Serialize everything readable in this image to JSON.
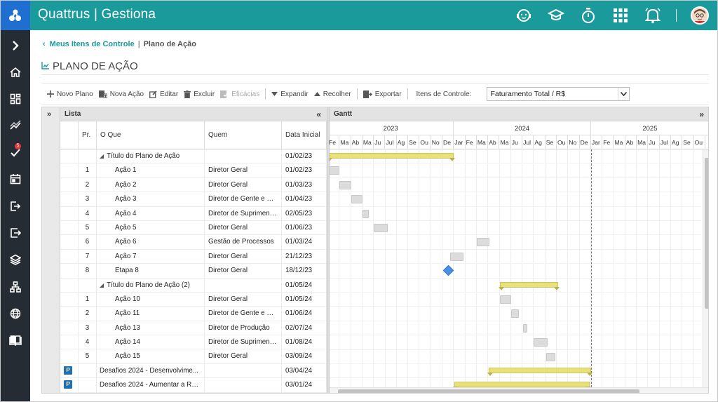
{
  "app": {
    "title": "Quattrus | Gestiona"
  },
  "topbar_icons": [
    "support-agent-icon",
    "graduation-cap-icon",
    "stopwatch-icon",
    "app-grid-icon",
    "bell-icon"
  ],
  "sidebar": {
    "items": [
      {
        "icon": "chevron-right-icon"
      },
      {
        "icon": "home-icon"
      },
      {
        "icon": "dashboard-icon"
      },
      {
        "icon": "trend-chart-icon"
      },
      {
        "icon": "tasks-check-icon",
        "badge": "5"
      },
      {
        "icon": "calendar-icon"
      },
      {
        "icon": "login-icon"
      },
      {
        "icon": "export-icon"
      },
      {
        "icon": "layers-icon"
      },
      {
        "icon": "sitemap-icon"
      },
      {
        "icon": "globe-icon"
      },
      {
        "icon": "book-icon"
      }
    ]
  },
  "breadcrumb": {
    "parent": "Meus Itens de Controle",
    "separator": "|",
    "current": "Plano de Ação"
  },
  "page": {
    "title": "PLANO DE AÇÃO"
  },
  "toolbar": {
    "novo_plano": "Novo Plano",
    "nova_acao": "Nova Ação",
    "editar": "Editar",
    "excluir": "Excluir",
    "eficacias": "Eficácias",
    "expandir": "Expandir",
    "recolher": "Recolher",
    "exportar": "Exportar",
    "itens_label": "Itens de Controle:",
    "itens_value": "Faturamento Total / R$"
  },
  "list": {
    "title": "Lista",
    "columns": {
      "pr": "Pr.",
      "oque": "O Que",
      "quem": "Quem",
      "data": "Data Inicial"
    },
    "rows": [
      {
        "type": "plan",
        "pr": "",
        "oque": "Título do Plano de Ação",
        "quem": "",
        "data": "01/02/23"
      },
      {
        "type": "action",
        "pr": "1",
        "oque": "Ação 1",
        "quem": "Diretor Geral",
        "data": "01/02/23"
      },
      {
        "type": "action",
        "pr": "2",
        "oque": "Ação 2",
        "quem": "Diretor Geral",
        "data": "01/03/23"
      },
      {
        "type": "action",
        "pr": "3",
        "oque": "Ação 3",
        "quem": "Diretor de Gente e Ge...",
        "data": "01/04/23"
      },
      {
        "type": "action",
        "pr": "4",
        "oque": "Ação 4",
        "quem": "Diretor de Suprimento...",
        "data": "02/05/23"
      },
      {
        "type": "action",
        "pr": "5",
        "oque": "Ação 5",
        "quem": "Diretor Geral",
        "data": "01/06/23"
      },
      {
        "type": "action",
        "pr": "6",
        "oque": "Ação 6",
        "quem": "Gestão de Processos",
        "data": "01/03/24"
      },
      {
        "type": "action",
        "pr": "7",
        "oque": "Ação 7",
        "quem": "Diretor Geral",
        "data": "21/12/23"
      },
      {
        "type": "action",
        "pr": "8",
        "oque": "Etapa 8",
        "quem": "Diretor Geral",
        "data": "18/12/23"
      },
      {
        "type": "plan",
        "pr": "",
        "oque": "Título do Plano de Ação (2)",
        "quem": "",
        "data": "01/05/24"
      },
      {
        "type": "action",
        "pr": "1",
        "oque": "Ação 10",
        "quem": "Diretor Geral",
        "data": "01/05/24"
      },
      {
        "type": "action",
        "pr": "2",
        "oque": "Ação 11",
        "quem": "Diretor de Gente e Ge...",
        "data": "01/06/24"
      },
      {
        "type": "action",
        "pr": "3",
        "oque": "Ação 13",
        "quem": "Diretor de Produção",
        "data": "02/07/24"
      },
      {
        "type": "action",
        "pr": "4",
        "oque": "Ação 14",
        "quem": "Diretor de Suprimento...",
        "data": "01/08/24"
      },
      {
        "type": "action",
        "pr": "5",
        "oque": "Ação 15",
        "quem": "Diretor Geral",
        "data": "03/09/24"
      },
      {
        "type": "project",
        "badge": "P",
        "pr": "",
        "oque": "Desafios 2024 - Desenvolvime...",
        "quem": "",
        "data": "03/04/24"
      },
      {
        "type": "project",
        "badge": "P",
        "pr": "",
        "oque": "Desafios 2024 - Aumentar a Re...",
        "quem": "",
        "data": "03/01/24"
      }
    ]
  },
  "gantt": {
    "title": "Gantt",
    "years": [
      "2023",
      "2024",
      "2025"
    ],
    "months": {
      "2023": [
        "Fe",
        "Ma",
        "Ab",
        "Ma",
        "Ju",
        "Jul",
        "Ag",
        "Se",
        "Ou",
        "No",
        "De"
      ],
      "2024": [
        "Jar",
        "Fe",
        "Ma",
        "Ab",
        "Ma",
        "Ju",
        "Jul",
        "Ag",
        "Se",
        "Ou",
        "No",
        "De"
      ],
      "2025": [
        "Jar",
        "Fe",
        "Ma",
        "Ab",
        "Ma",
        "Ju",
        "Jul",
        "Ag",
        "Se",
        "Ou"
      ]
    }
  }
}
